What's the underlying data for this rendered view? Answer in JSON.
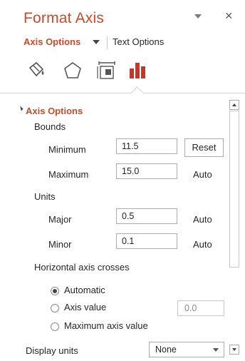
{
  "header": {
    "title": "Format Axis",
    "title_dropdown_icon": "chevron-down-icon",
    "close_label": "×"
  },
  "tabs": {
    "axis_options": "Axis Options",
    "text_options": "Text Options"
  },
  "category_icons": [
    "fill-line-icon",
    "effects-icon",
    "size-properties-icon",
    "axis-options-icon"
  ],
  "section": {
    "title": "Axis Options",
    "bounds_label": "Bounds",
    "minimum_label": "Minimum",
    "minimum_value": "11.5",
    "reset_label": "Reset",
    "maximum_label": "Maximum",
    "maximum_value": "15.0",
    "maximum_auto": "Auto",
    "units_label": "Units",
    "major_label": "Major",
    "major_value": "0.5",
    "major_auto": "Auto",
    "minor_label": "Minor",
    "minor_value": "0.1",
    "minor_auto": "Auto",
    "h_axis_crosses_label": "Horizontal axis crosses",
    "radio_automatic": "Automatic",
    "radio_axis_value": "Axis value",
    "axis_value_field": "0.0",
    "radio_max_axis_value": "Maximum axis value",
    "selected_radio": "Automatic",
    "display_units_label": "Display units",
    "display_units_value": "None"
  },
  "colors": {
    "accent": "#d24726",
    "text": "#262626",
    "border": "#ababab"
  }
}
